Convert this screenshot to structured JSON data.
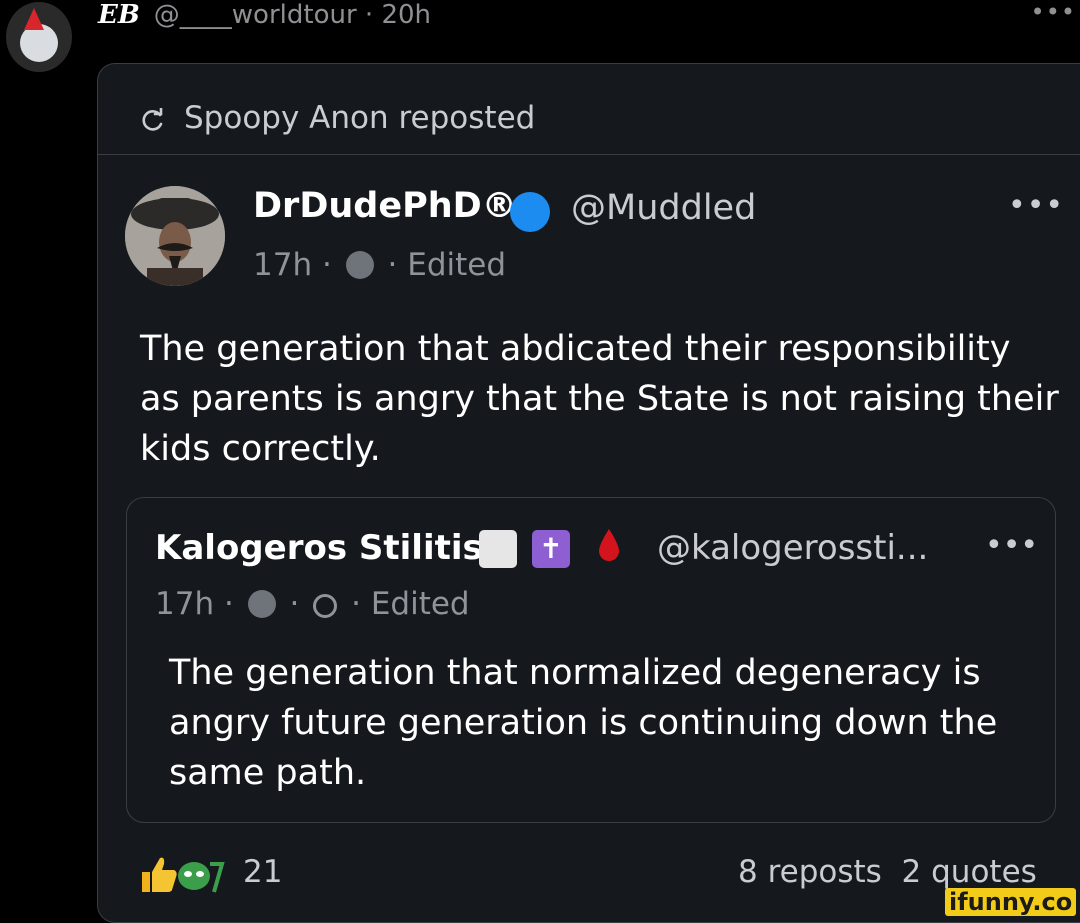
{
  "outer": {
    "name": "EB",
    "handle_time": "@____worldtour · 20h",
    "more": "•••"
  },
  "repost": {
    "label": "Spoopy Anon reposted"
  },
  "post": {
    "author_name": "DrDudePhD®",
    "author_handle": "@Muddled",
    "time": "17h ·",
    "edited": "· Edited",
    "more": "•••",
    "body": "The generation that abdicated their responsibility as parents is angry that the State is not raising their kids correctly."
  },
  "quote": {
    "author_name": "Kalogeros Stilitis",
    "author_handle": "@kalogerossti...",
    "cross_glyph": "✝",
    "time": "17h ·",
    "edited": "· Edited",
    "more": "•••",
    "body": "The generation that normalized degeneracy is angry future generation is continuing down the same path."
  },
  "footer": {
    "reaction_count": "21",
    "reposts": "8 reposts",
    "quotes": "2 quotes"
  },
  "watermark": "ifunny.co",
  "colors": {
    "background": "#000000",
    "card": "#15181c",
    "border": "#3a3d42",
    "verified": "#1d8cf0",
    "muted": "#8f939a",
    "watermark": "#f3cc1a"
  }
}
